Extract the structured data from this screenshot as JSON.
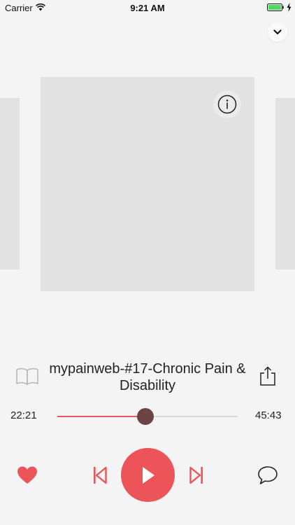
{
  "status_bar": {
    "carrier": "Carrier",
    "time": "9:21 AM"
  },
  "player": {
    "title": "mypainweb-#17-Chronic Pain & Disability",
    "elapsed": "22:21",
    "total": "45:43",
    "progress_fraction": 0.489
  },
  "colors": {
    "accent": "#ec5459",
    "thumb": "#6b4446",
    "battery": "#4cd964"
  },
  "icons": {
    "collapse": "chevron-down-icon",
    "info": "info-icon",
    "book": "book-icon",
    "share": "share-icon",
    "favorite": "heart-icon",
    "previous": "skip-previous-icon",
    "play": "play-icon",
    "next": "skip-next-icon",
    "comment": "comment-icon"
  }
}
